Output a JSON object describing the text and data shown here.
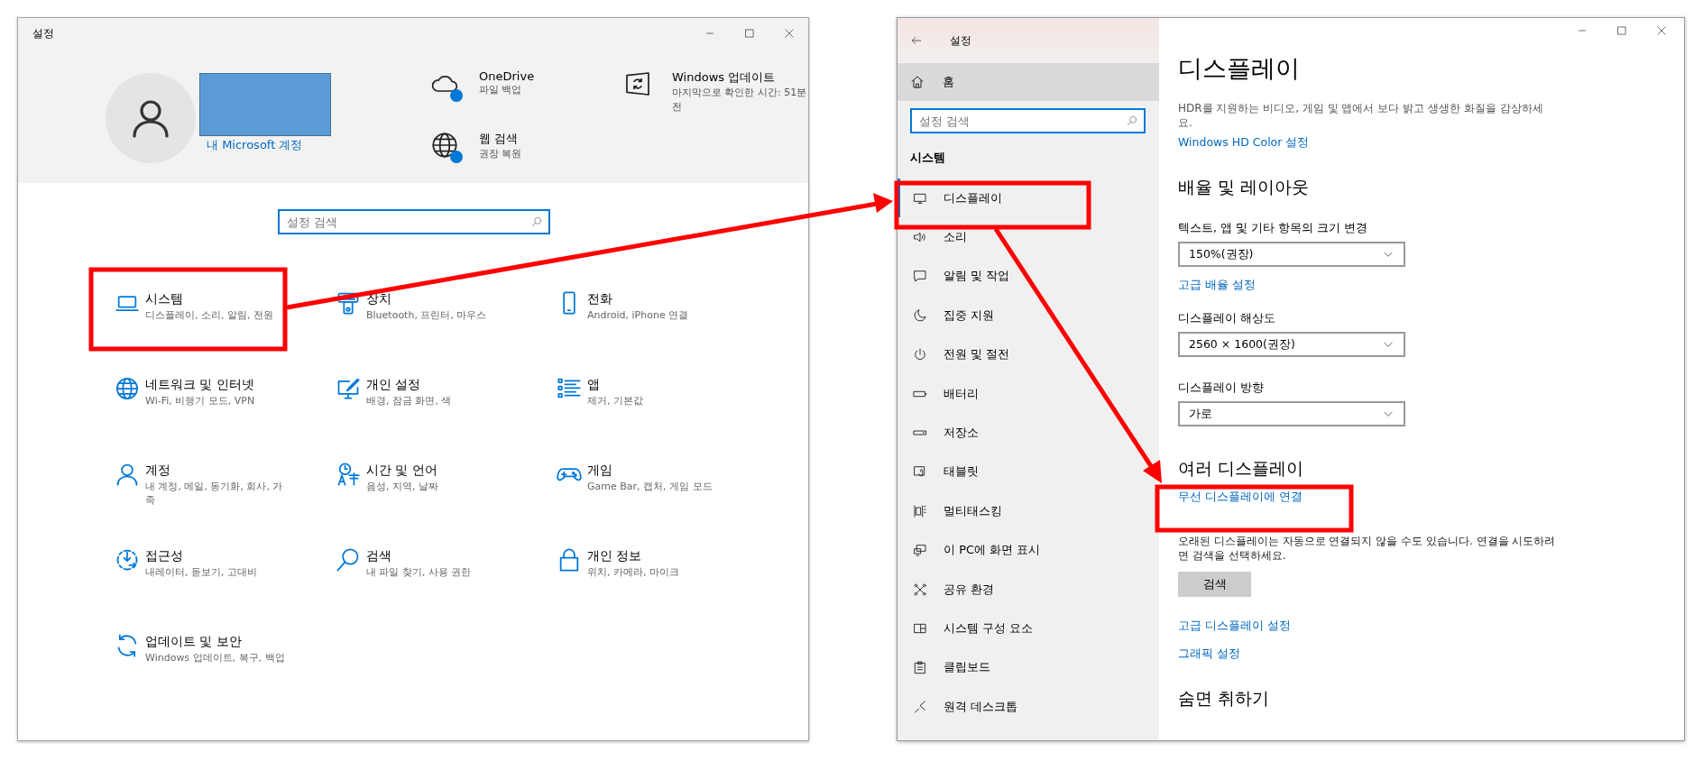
{
  "settings_home": {
    "window": {
      "title": "설정"
    },
    "account": {
      "link": "내 Microsoft 계정"
    },
    "quick_links": [
      {
        "title": "OneDrive",
        "subtitle": "파일 백업",
        "badge": true
      },
      {
        "title": "Windows 업데이트",
        "subtitle": "마지막으로 확인한 시간: 51분 전",
        "badge": false
      },
      {
        "title": "웹 검색",
        "subtitle": "권장 복원",
        "badge": true
      }
    ],
    "search": {
      "placeholder": "설정 검색"
    },
    "categories": [
      {
        "title": "시스템",
        "subtitle": "디스플레이, 소리, 알림, 전원"
      },
      {
        "title": "장치",
        "subtitle": "Bluetooth, 프린터, 마우스"
      },
      {
        "title": "전화",
        "subtitle": "Android, iPhone 연결"
      },
      {
        "title": "네트워크 및 인터넷",
        "subtitle": "Wi-Fi, 비행기 모드, VPN"
      },
      {
        "title": "개인 설정",
        "subtitle": "배경, 잠금 화면, 색"
      },
      {
        "title": "앱",
        "subtitle": "제거, 기본값"
      },
      {
        "title": "계정",
        "subtitle": "내 계정, 메일, 동기화, 회사, 가족"
      },
      {
        "title": "시간 및 언어",
        "subtitle": "음성, 지역, 날짜"
      },
      {
        "title": "게임",
        "subtitle": "Game Bar, 캡처, 게임 모드"
      },
      {
        "title": "접근성",
        "subtitle": "내레이터, 돋보기, 고대비"
      },
      {
        "title": "검색",
        "subtitle": "내 파일 찾기, 사용 권한"
      },
      {
        "title": "개인 정보",
        "subtitle": "위치, 카메라, 마이크"
      },
      {
        "title": "업데이트 및 보안",
        "subtitle": "Windows 업데이트, 복구, 백업"
      }
    ]
  },
  "display_settings": {
    "window": {
      "title": "설정"
    },
    "sidebar": {
      "home": "홈",
      "search": {
        "placeholder": "설정 검색"
      },
      "section": "시스템",
      "items": [
        {
          "label": "디스플레이",
          "selected": true
        },
        {
          "label": "소리",
          "selected": false
        },
        {
          "label": "알림 및 작업",
          "selected": false
        },
        {
          "label": "집중 지원",
          "selected": false
        },
        {
          "label": "전원 및 절전",
          "selected": false
        },
        {
          "label": "배터리",
          "selected": false
        },
        {
          "label": "저장소",
          "selected": false
        },
        {
          "label": "태블릿",
          "selected": false
        },
        {
          "label": "멀티태스킹",
          "selected": false
        },
        {
          "label": "이 PC에 화면 표시",
          "selected": false
        },
        {
          "label": "공유 환경",
          "selected": false
        },
        {
          "label": "시스템 구성 요소",
          "selected": false
        },
        {
          "label": "클립보드",
          "selected": false
        },
        {
          "label": "원격 데스크톱",
          "selected": false
        }
      ]
    },
    "content": {
      "heading": "디스플레이",
      "blocks": [
        {
          "kind": "text",
          "text": "HDR를 지원하는 비디오, 게임 및 앱에서 보다 밝고 생생한 화질을 감상하세요."
        },
        {
          "kind": "link",
          "text": "Windows HD Color 설정"
        },
        {
          "kind": "heading",
          "text": "배율 및 레이아웃"
        },
        {
          "kind": "label",
          "text": "텍스트, 앱 및 기타 항목의 크기 변경"
        },
        {
          "kind": "dropdown",
          "text": "150%(권장)"
        },
        {
          "kind": "link",
          "text": "고급 배율 설정"
        },
        {
          "kind": "label",
          "text": "디스플레이 해상도"
        },
        {
          "kind": "dropdown",
          "text": "2560 × 1600(권장)"
        },
        {
          "kind": "label",
          "text": "디스플레이 방향"
        },
        {
          "kind": "dropdown",
          "text": "가로"
        },
        {
          "kind": "heading",
          "text": "여러 디스플레이"
        },
        {
          "kind": "link",
          "text": "무선 디스플레이에 연결"
        },
        {
          "kind": "text",
          "text": "오래된 디스플레이는 자동으로 연결되지 않을 수도 있습니다. 연결을 시도하려면 검색을 선택하세요."
        },
        {
          "kind": "button",
          "text": "검색"
        },
        {
          "kind": "link",
          "text": "고급 디스플레이 설정"
        },
        {
          "kind": "link",
          "text": "그래픽 설정"
        },
        {
          "kind": "heading",
          "text": "숨면 취하기"
        }
      ]
    }
  }
}
